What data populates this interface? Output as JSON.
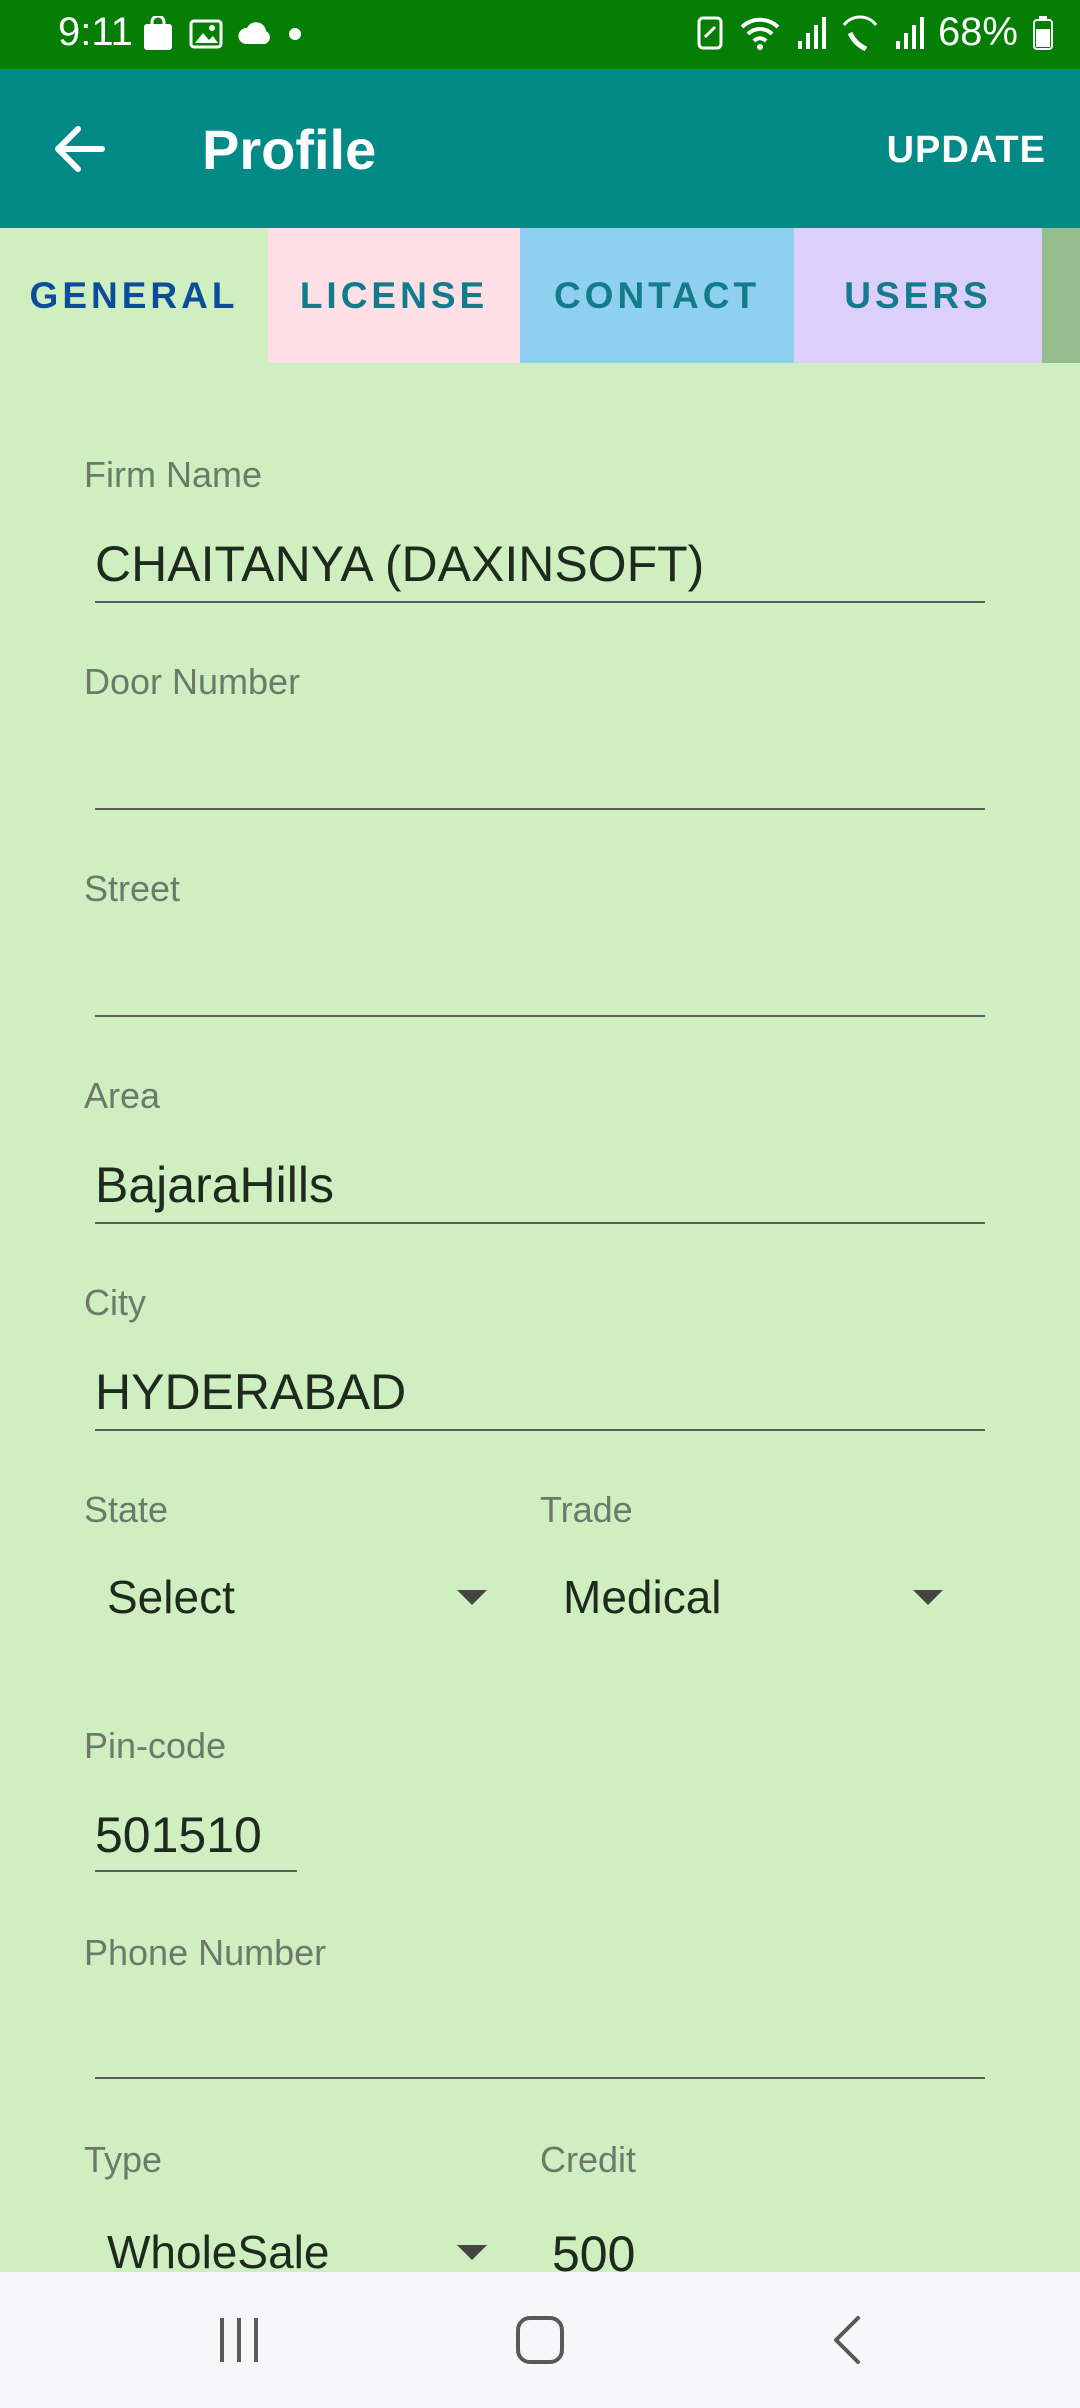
{
  "status": {
    "time": "9:11",
    "battery": "68%"
  },
  "appbar": {
    "title": "Profile",
    "action": "UPDATE"
  },
  "tabs": [
    {
      "label": "GENERAL"
    },
    {
      "label": "LICENSE"
    },
    {
      "label": "CONTACT"
    },
    {
      "label": "USERS"
    }
  ],
  "form": {
    "firm_name": {
      "label": "Firm Name",
      "value": "CHAITANYA (DAXINSOFT)"
    },
    "door_number": {
      "label": "Door Number",
      "value": ""
    },
    "street": {
      "label": "Street",
      "value": ""
    },
    "area": {
      "label": "Area",
      "value": "BajaraHills"
    },
    "city": {
      "label": "City",
      "value": "HYDERABAD"
    },
    "state": {
      "label": "State",
      "value": "Select"
    },
    "trade": {
      "label": "Trade",
      "value": "Medical"
    },
    "pincode": {
      "label": "Pin-code",
      "value": "501510"
    },
    "phone": {
      "label": "Phone Number",
      "value": ""
    },
    "type": {
      "label": "Type",
      "value": "WholeSale"
    },
    "credit": {
      "label": "Credit",
      "value": "500"
    }
  },
  "colors": {
    "status_bar": "#047e04",
    "app_bar": "#028a87",
    "form_bg": "#d0efc0",
    "tab_general_text": "#0b4d9b",
    "tab_license_bg": "#fde0e6",
    "tab_contact_bg": "#8fd0f0",
    "tab_users_bg": "#dccffc"
  }
}
